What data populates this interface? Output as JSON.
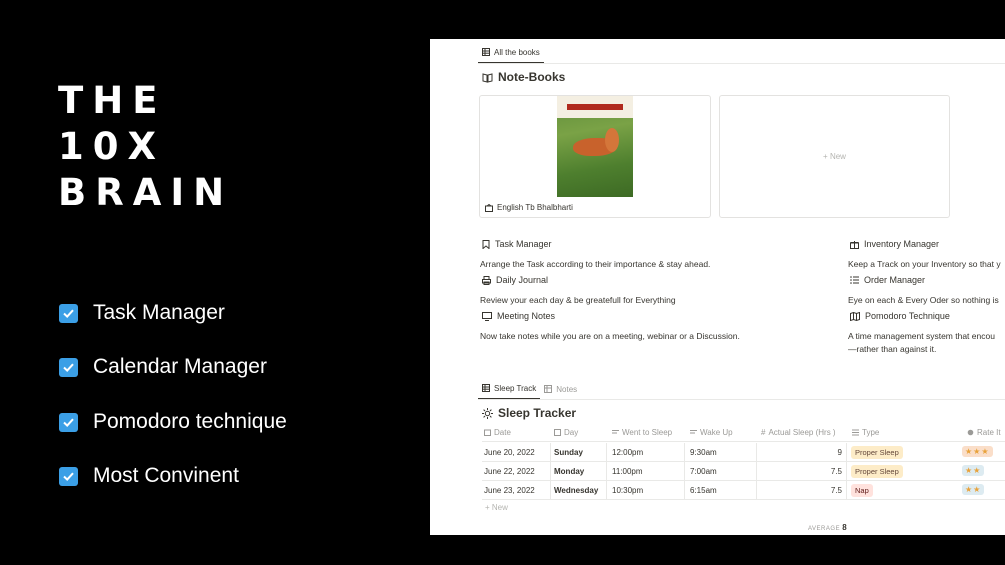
{
  "promo": {
    "title_lines": [
      "THE",
      "10X",
      "BRAIN"
    ],
    "features": [
      "Task Manager",
      "Calendar Manager",
      "Pomodoro technique",
      "Most Convinent"
    ],
    "accent": "#3b9fe6"
  },
  "books_view": {
    "tab": "All the books",
    "title": "Note-Books",
    "card_label": "English Tb Bhalbharti",
    "cover_text": "KUMARBHARTI",
    "new_label": "+ New"
  },
  "tools": [
    {
      "name": "Task Manager",
      "desc": "Arrange the Task according to their importance & stay ahead.",
      "icon": "bookmark-icon"
    },
    {
      "name": "Daily Journal",
      "desc": "Review your each day & be greatefull for Everything",
      "icon": "printer-icon"
    },
    {
      "name": "Meeting Notes",
      "desc": "Now take notes while you are on a meeting, webinar or a Discussion.",
      "icon": "screen-icon"
    },
    {
      "name": "Inventory Manager",
      "desc": "Keep a Track on your Inventory so that y",
      "icon": "gift-icon"
    },
    {
      "name": "Order Manager",
      "desc": "Eye on each & Every Oder so nothing is",
      "icon": "list-icon"
    },
    {
      "name": "Pomodoro Technique",
      "desc": "A time management system that encou",
      "desc2": "—rather than against it.",
      "icon": "map-icon"
    }
  ],
  "sleep": {
    "tabs": [
      "Sleep Track",
      "Notes"
    ],
    "title": "Sleep Tracker",
    "columns": [
      "Date",
      "Day",
      "Went to Sleep",
      "Wake Up",
      "Actual Sleep (Hrs )",
      "Type",
      "Rate It"
    ],
    "rows": [
      {
        "date": "June 20, 2022",
        "day": "Sunday",
        "sleep": "12:00pm",
        "wake": "9:30am",
        "actual": "9",
        "type": "Proper Sleep",
        "rate": "★★★"
      },
      {
        "date": "June 22, 2022",
        "day": "Monday",
        "sleep": "11:00pm",
        "wake": "7:00am",
        "actual": "7.5",
        "type": "Proper Sleep",
        "rate": "★★"
      },
      {
        "date": "June 23, 2022",
        "day": "Wednesday",
        "sleep": "10:30pm",
        "wake": "6:15am",
        "actual": "7.5",
        "type": "Nap",
        "rate": "★★"
      }
    ],
    "new_label": "+ New",
    "average_label": "AVERAGE",
    "average_value": "8"
  }
}
